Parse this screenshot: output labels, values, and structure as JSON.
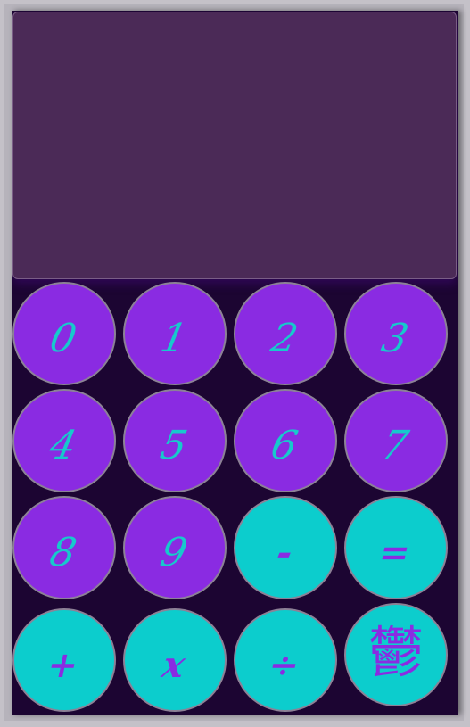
{
  "display": {
    "value": ""
  },
  "keypad": {
    "keys": [
      {
        "label": "0",
        "kind": "digit"
      },
      {
        "label": "1",
        "kind": "digit"
      },
      {
        "label": "2",
        "kind": "digit"
      },
      {
        "label": "3",
        "kind": "digit"
      },
      {
        "label": "4",
        "kind": "digit"
      },
      {
        "label": "5",
        "kind": "digit"
      },
      {
        "label": "6",
        "kind": "digit"
      },
      {
        "label": "7",
        "kind": "digit"
      },
      {
        "label": "8",
        "kind": "digit"
      },
      {
        "label": "9",
        "kind": "digit"
      },
      {
        "label": "-",
        "kind": "operator"
      },
      {
        "label": "=",
        "kind": "operator"
      },
      {
        "label": "+",
        "kind": "operator"
      },
      {
        "label": "x",
        "kind": "operator"
      },
      {
        "label": "÷",
        "kind": "operator"
      },
      {
        "label": "鬱",
        "kind": "clear"
      }
    ]
  },
  "colors": {
    "digit_key_bg": "#8a2be2",
    "digit_key_text": "#17c9cc",
    "operator_key_bg": "#0ccdcd",
    "operator_key_text": "#8a2be2",
    "display_bg": "#4b2a57",
    "body_bg": "#1c0532"
  }
}
